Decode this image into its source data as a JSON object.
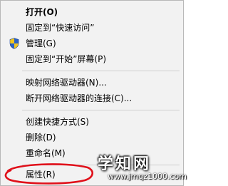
{
  "menu": {
    "items": [
      {
        "label": "打开(O)"
      },
      {
        "label": "固定到“快速访问”"
      },
      {
        "label": "管理(G)",
        "icon": "uac-shield-icon"
      },
      {
        "label": "固定到“开始”屏幕(P)"
      },
      {
        "label": "映射网络驱动器(N)..."
      },
      {
        "label": "断开网络驱动器的连接(C)..."
      },
      {
        "label": "创建快捷方式(S)"
      },
      {
        "label": "删除(D)"
      },
      {
        "label": "重命名(M)"
      },
      {
        "label": "属性(R)"
      }
    ]
  },
  "watermark": {
    "title": "学知网",
    "url": "www.jmqz1000.com"
  },
  "colors": {
    "menu_background": "#f2f2f2",
    "separator": "#cfcfcf",
    "highlight_ellipse": "#e0101a"
  }
}
